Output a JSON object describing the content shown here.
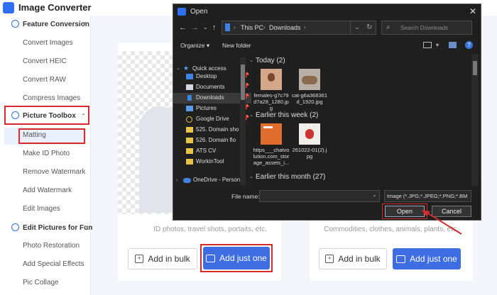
{
  "app": {
    "title": "Image Converter",
    "accent": "#2f6ff0",
    "highlight": "#d42b2b"
  },
  "sidebar": {
    "sections": [
      {
        "label": "Feature Conversion",
        "icon": "feature-conversion-icon",
        "items": [
          "Convert Images",
          "Convert HEIC",
          "Convert RAW",
          "Compress Images"
        ]
      },
      {
        "label": "Picture Toolbox",
        "icon": "picture-toolbox-icon",
        "items": [
          "Matting",
          "Make ID Photo",
          "Remove Watermark",
          "Add Watermark",
          "Edit Images"
        ]
      },
      {
        "label": "Edit Pictures for Fun",
        "icon": "edit-fun-icon",
        "items": [
          "Photo Restoration",
          "Add Special Effects",
          "Pic Collage"
        ]
      }
    ]
  },
  "main": {
    "cards": [
      {
        "caption": "ID photos, travel shots, portaits, etc.",
        "bulk_label": "Add in bulk",
        "one_label": "Add just one"
      },
      {
        "caption": "Commodities, clothes, animals, plants, etc.",
        "bulk_label": "Add in bulk",
        "one_label": "Add just one"
      }
    ]
  },
  "dialog": {
    "title": "Open",
    "breadcrumb": [
      "This PC",
      "Downloads"
    ],
    "search_placeholder": "Search Downloads",
    "organize_label": "Organize",
    "new_folder_label": "New folder",
    "nav": {
      "quick_access": "Quick access",
      "items": [
        "Desktop",
        "Documents",
        "Downloads",
        "Pictures",
        "Google Drive",
        "525. Domain sho",
        "526. Domain flo",
        "ATS CV",
        "WorkinTool"
      ],
      "onedrive": "OneDrive - Person"
    },
    "groups": [
      {
        "label": "Today (2)",
        "files": [
          "females-g7c79d7a28_1280.jpg",
          "cat-g6a368361d_1920.jpg"
        ]
      },
      {
        "label": "Earlier this week (2)",
        "files": [
          "https___chatvolution.com_storage_assets_i...",
          "261022-01(2).jpg"
        ]
      },
      {
        "label": "Earlier this month (27)",
        "files": []
      }
    ],
    "file_name_label": "File name:",
    "file_name_value": "",
    "file_type_value": "Image (*.JPG;*.JPEG;*.PNG;*.BM",
    "open_label": "Open",
    "cancel_label": "Cancel"
  }
}
